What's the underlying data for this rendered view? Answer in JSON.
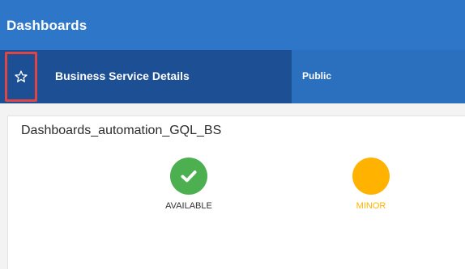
{
  "header": {
    "title": "Dashboards"
  },
  "subheader": {
    "favorite_icon": "star-outline-icon",
    "service_name": "Business Service Details",
    "visibility": "Public"
  },
  "panel": {
    "title": "Dashboards_automation_GQL_BS",
    "statuses": [
      {
        "label": "AVAILABLE",
        "icon": "checkmark-icon",
        "color": "#4caf50"
      },
      {
        "label": "MINOR",
        "icon": "circle-icon",
        "color": "#ffb300"
      }
    ]
  },
  "colors": {
    "header_bg": "#2e76c8",
    "subheader_dark": "#1c4f94",
    "subheader_light": "#2b6fbf",
    "highlight_border": "#e04545",
    "available": "#4caf50",
    "minor": "#ffb300"
  }
}
